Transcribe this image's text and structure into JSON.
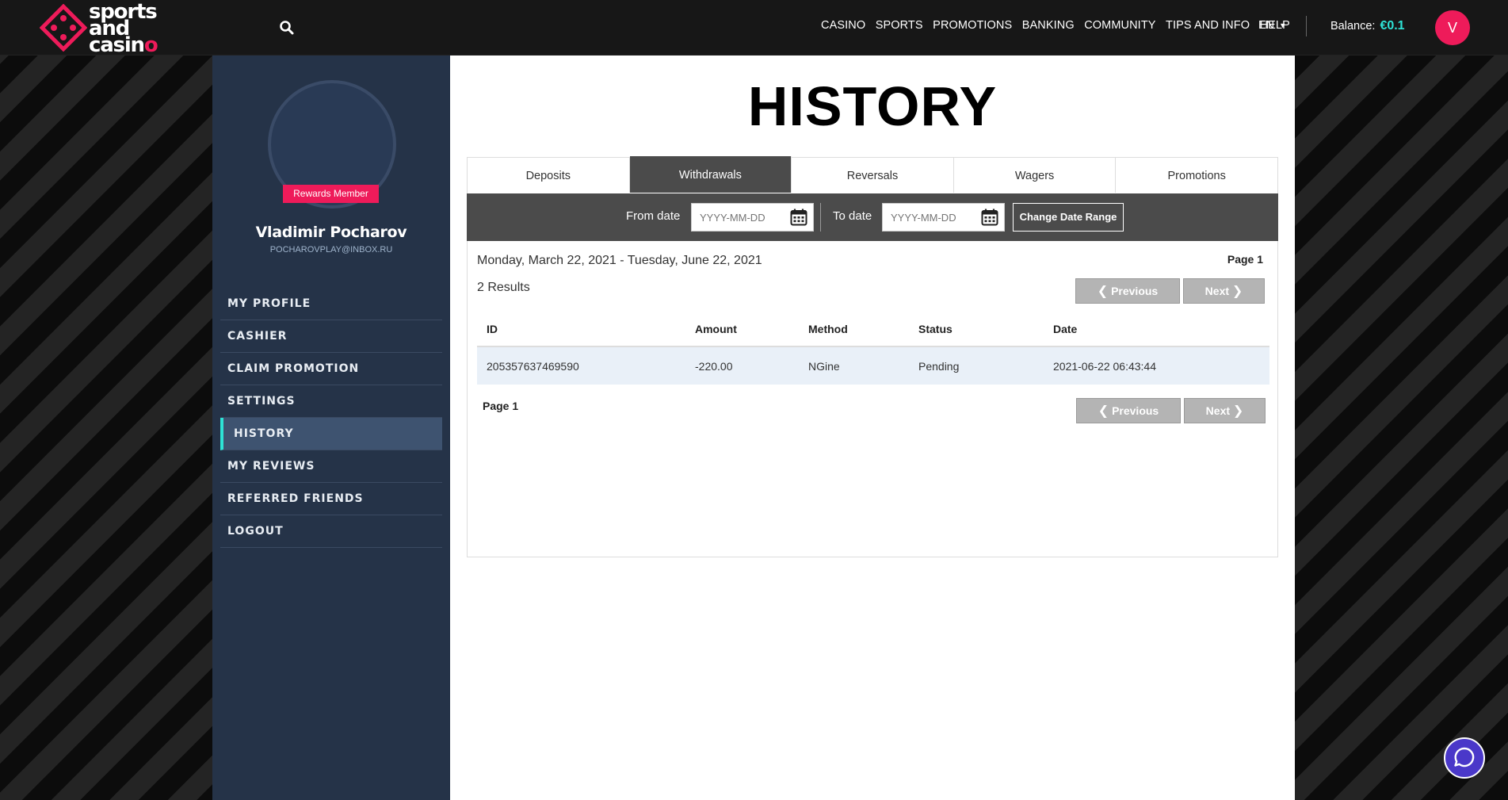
{
  "brand": {
    "line1": "sports",
    "line2": "and",
    "line3_main": "casin",
    "line3_accent": "o"
  },
  "nav": {
    "items": [
      "CASINO",
      "SPORTS",
      "PROMOTIONS",
      "BANKING",
      "COMMUNITY",
      "TIPS AND INFO",
      "HELP"
    ],
    "language": "EN"
  },
  "account": {
    "balance_label": "Balance:",
    "balance_value": "€0.1",
    "avatar_initial": "V"
  },
  "sidebar": {
    "badge": "Rewards Member",
    "name": "Vladimir Pocharov",
    "email": "POCHAROVPLAY@INBOX.RU",
    "items": [
      "MY PROFILE",
      "CASHIER",
      "CLAIM PROMOTION",
      "SETTINGS",
      "HISTORY",
      "MY REVIEWS",
      "REFERRED FRIENDS",
      "LOGOUT"
    ],
    "active_item": "HISTORY"
  },
  "main": {
    "title": "HISTORY",
    "tabs": [
      "Deposits",
      "Withdrawals",
      "Reversals",
      "Wagers",
      "Promotions"
    ],
    "active_tab": "Withdrawals",
    "filter": {
      "from_label": "From date",
      "to_label": "To date",
      "placeholder": "YYYY-MM-DD",
      "button": "Change Date Range"
    },
    "range": "Monday, March 22, 2021 - Tuesday, June 22, 2021",
    "page_label": "Page 1",
    "results": "2 Results",
    "prev_label": "Previous",
    "next_label": "Next",
    "table": {
      "headers": [
        "ID",
        "Amount",
        "Method",
        "Status",
        "Date"
      ],
      "rows": [
        [
          "205357637469590",
          "-220.00",
          "NGine",
          "Pending",
          "2021-06-22 06:43:44"
        ]
      ]
    }
  },
  "colors": {
    "accent": "#ee1b5a",
    "teal": "#2ee3d6",
    "sidebar": "#253348",
    "filterbar": "#4b4b4b"
  }
}
